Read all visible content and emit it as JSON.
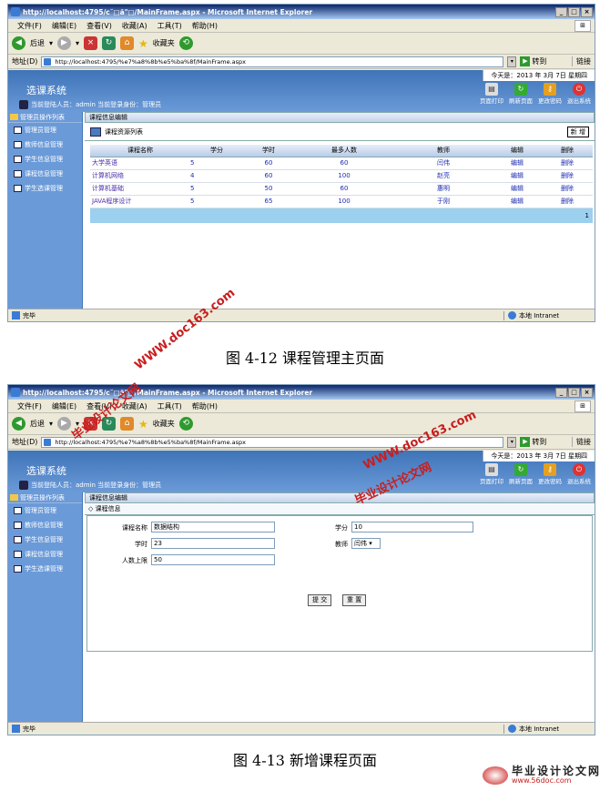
{
  "browser": {
    "title1": "http://localhost:4795/c˘□ã\"□/MainFrame.aspx - Microsoft Internet Explorer",
    "title2": "http://localhost:4795/c˘□ã\"□/MainFrame.aspx - Microsoft Internet Explorer",
    "menu": [
      "文件(F)",
      "编辑(E)",
      "查看(V)",
      "收藏(A)",
      "工具(T)",
      "帮助(H)"
    ],
    "back": "后退",
    "favorites": "收藏夹",
    "address_label": "地址(D)",
    "address": "http://localhost:4795/%e7%a8%8b%e5%ba%8f/MainFrame.aspx",
    "go": "转到",
    "links": "链接",
    "status_done": "完毕",
    "zone": "本地 Intranet",
    "min": "_",
    "max": "□",
    "close": "×",
    "dropdown": "▾"
  },
  "app": {
    "date": "今天是：2013 年 3月 7日 星期四",
    "title": "选课系统",
    "user": "当前登陆人员：admin 当前登录身份：管理员",
    "actions": [
      "页面打印",
      "刷新页面",
      "更改密码",
      "退出系统"
    ],
    "sidebar_head": "管理员操作列表",
    "sidebar": [
      "管理员管理",
      "教师信息管理",
      "学生信息管理",
      "课程信息管理",
      "学生选课管理"
    ]
  },
  "list_page": {
    "panel": "课程信息编辑",
    "list_title": "课程资源列表",
    "add": "新 增",
    "columns": [
      "课程名称",
      "学分",
      "学时",
      "最多人数",
      "教师",
      "编辑",
      "删除"
    ],
    "rows": [
      [
        "大学英语",
        "5",
        "60",
        "60",
        "闫伟",
        "编辑",
        "删除"
      ],
      [
        "计算机网络",
        "4",
        "60",
        "100",
        "赵亮",
        "编辑",
        "删除"
      ],
      [
        "计算机基础",
        "5",
        "50",
        "60",
        "惠明",
        "编辑",
        "删除"
      ],
      [
        "JAVA程序设计",
        "5",
        "65",
        "100",
        "于刚",
        "编辑",
        "删除"
      ]
    ],
    "page": "1"
  },
  "form_page": {
    "panel": "课程信息编辑",
    "section": "课程信息",
    "labels": {
      "name": "课程名称",
      "credit": "学分",
      "hours": "学时",
      "teacher": "教师",
      "max": "人数上限"
    },
    "values": {
      "name": "数据结构",
      "credit": "10",
      "hours": "23",
      "teacher": "闫伟",
      "max": "50"
    },
    "submit": "提 交",
    "reset": "重 置"
  },
  "captions": [
    "图 4-12 课程管理主页面",
    "图 4-13  新增课程页面"
  ],
  "watermarks": {
    "site": "WWW.doc163.com",
    "brand": "毕业设计论文网",
    "bottom_brand": "毕业设计论文网",
    "bottom_url": "www.56doc.com"
  }
}
